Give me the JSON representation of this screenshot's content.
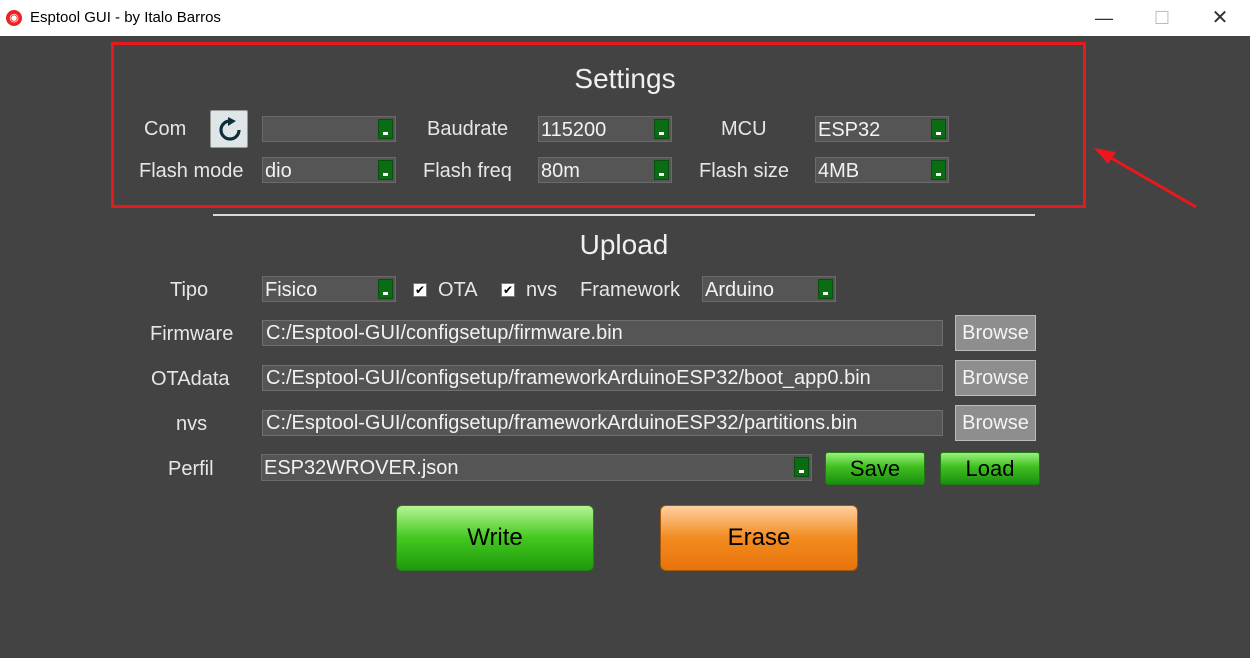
{
  "window": {
    "title": "Esptool GUI - by Italo Barros",
    "minimize_glyph": "—",
    "maximize_glyph": "☐",
    "close_glyph": "✕"
  },
  "settings": {
    "heading": "Settings",
    "com": {
      "label": "Com",
      "value": ""
    },
    "baudrate": {
      "label": "Baudrate",
      "value": "115200"
    },
    "mcu": {
      "label": "MCU",
      "value": "ESP32"
    },
    "flash_mode": {
      "label": "Flash mode",
      "value": "dio"
    },
    "flash_freq": {
      "label": "Flash freq",
      "value": "80m"
    },
    "flash_size": {
      "label": "Flash size",
      "value": "4MB"
    }
  },
  "upload": {
    "heading": "Upload",
    "tipo": {
      "label": "Tipo",
      "value": "Fisico"
    },
    "ota": {
      "label": "OTA",
      "checked": true,
      "glyph": "✔"
    },
    "nvs_check": {
      "label": "nvs",
      "checked": true,
      "glyph": "✔"
    },
    "framework": {
      "label": "Framework",
      "value": "Arduino"
    },
    "firmware": {
      "label": "Firmware",
      "value": "C:/Esptool-GUI/configsetup/firmware.bin"
    },
    "otadata": {
      "label": "OTAdata",
      "value": "C:/Esptool-GUI/configsetup/frameworkArduinoESP32/boot_app0.bin"
    },
    "nvs": {
      "label": "nvs",
      "value": "C:/Esptool-GUI/configsetup/frameworkArduinoESP32/partitions.bin"
    },
    "browse_label": "Browse",
    "perfil": {
      "label": "Perfil",
      "value": "ESP32WROVER.json"
    },
    "save_label": "Save",
    "load_label": "Load"
  },
  "actions": {
    "write_label": "Write",
    "erase_label": "Erase"
  },
  "colors": {
    "highlight_box": "#e8181c",
    "background": "#434343",
    "dropdown_arrow": "#0b6d13"
  }
}
